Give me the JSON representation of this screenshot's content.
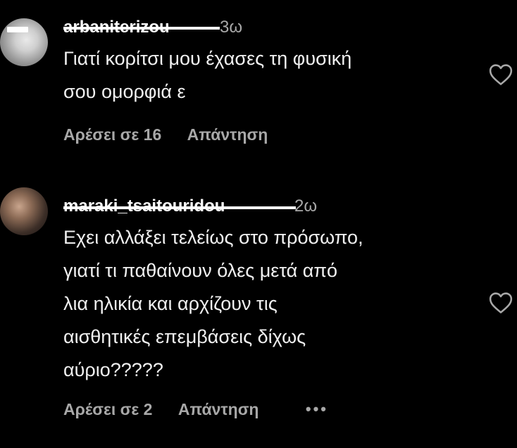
{
  "comments": [
    {
      "username": "arbaniterizou",
      "time": "3ω",
      "text_lines": [
        "Γιατί κορίτσι μου έχασες τη φυσική",
        "σου ομορφιά ε"
      ],
      "likes": "Αρέσει σε 16",
      "reply": "Απάντηση",
      "icons": [
        "avatar",
        "heart-icon"
      ]
    },
    {
      "username": "maraki_tsaitouridou",
      "time": "2ω",
      "text_lines": [
        "Εχει αλλάξει τελείως στο πρόσωπο,",
        "γιατί τι παθαίνουν όλες μετά από",
        "λια ηλικία και αρχίζουν τις",
        "αισθητικές επεμβάσεις δίχως",
        "αύριο?????"
      ],
      "likes": "Αρέσει σε 2",
      "reply": "Απάντηση",
      "more": "•••",
      "icons": [
        "avatar",
        "heart-icon",
        "more-icon"
      ]
    }
  ],
  "colors": {
    "background": "#000000",
    "text": "#f0f0f0",
    "secondary": "#a8a8a8"
  }
}
